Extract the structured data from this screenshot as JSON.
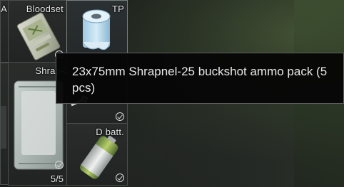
{
  "inventory": {
    "cells": [
      {
        "id": "cut-left",
        "label": "A",
        "checked": false,
        "icon": "partial-item"
      },
      {
        "id": "bloodset",
        "label": "Bloodset",
        "checked": true,
        "icon": "bloodset-kit-icon"
      },
      {
        "id": "tp",
        "label": "TP",
        "checked": false,
        "icon": "toilet-paper-icon",
        "highlighted": true
      },
      {
        "id": "shrapnel",
        "label": "Shrap-2",
        "checked": true,
        "icon": "shrapnel-ammo-pack-icon",
        "count": "5/5"
      },
      {
        "id": "wrench",
        "label": "",
        "checked": true,
        "icon": "wrench-icon"
      },
      {
        "id": "dbatt",
        "label": "D batt.",
        "checked": true,
        "icon": "d-battery-icon"
      }
    ]
  },
  "tooltip": {
    "text": "23x75mm Shrapnel-25 buckshot ammo pack (5 pcs)"
  },
  "colors": {
    "tooltip_bg": "#060606",
    "tooltip_border": "#5c5f5d",
    "cell_border": "#4a4f4d",
    "highlight_border": "#7a7f7d"
  }
}
